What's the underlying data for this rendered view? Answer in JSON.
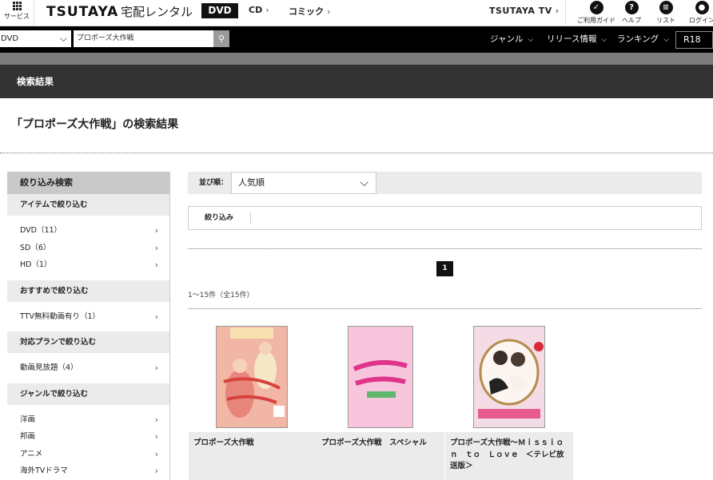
{
  "topbar": {
    "service_label": "サービス",
    "logo": "TSUTAYA",
    "service_name": "宅配レンタル",
    "tabs": [
      {
        "label": "DVD"
      },
      {
        "label": "CD"
      },
      {
        "label": "コミック"
      }
    ],
    "tsutaya_tv": "TSUTAYA TV",
    "icons": [
      {
        "icon": "guide-icon",
        "label": "ご利用ガイド"
      },
      {
        "icon": "help-icon",
        "label": "ヘルプ"
      },
      {
        "icon": "list-icon",
        "label": "リスト"
      },
      {
        "icon": "login-icon",
        "label": "ログイン"
      }
    ]
  },
  "searchbar": {
    "category": "DVD",
    "query": "プロポーズ大作戦",
    "nav": [
      {
        "label": "ジャンル"
      },
      {
        "label": "リリース情報"
      },
      {
        "label": "ランキング"
      }
    ],
    "r18": "R18"
  },
  "page": {
    "section_title": "検索結果",
    "heading": "「プロポーズ大作戦」の検索結果"
  },
  "sidebar": {
    "title": "絞り込み検索",
    "groups": [
      {
        "label": "アイテムで絞り込む",
        "items": [
          "DVD（11）",
          "SD（6）",
          "HD（1）"
        ]
      },
      {
        "label": "おすすめで絞り込む",
        "items": [
          "TTV無料動画有り（1）"
        ]
      },
      {
        "label": "対応プランで絞り込む",
        "items": [
          "動画見放題（4）"
        ]
      },
      {
        "label": "ジャンルで絞り込む",
        "items": [
          "洋画",
          "邦画",
          "アニメ",
          "海外TVドラマ"
        ]
      }
    ]
  },
  "results": {
    "sort_label": "並び順：",
    "sort_value": "人気順",
    "filter_label": "絞り込み",
    "page": "1",
    "count": "1〜15件（全15件）",
    "items": [
      {
        "title": "プロポーズ大作戦"
      },
      {
        "title": "プロポーズ大作戦　スペシャル"
      },
      {
        "title": "プロポーズ大作戦〜Ｍｉｓｓｉｏｎ　ｔｏ　Ｌｏｖｅ　＜テレビ放送版＞"
      }
    ]
  },
  "colors": {
    "header_black": "#000000",
    "result_bar": "#333333",
    "panel_grey": "#ebebeb"
  }
}
